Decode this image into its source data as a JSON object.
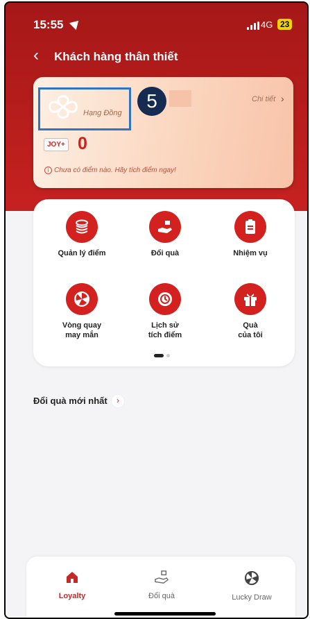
{
  "status_bar": {
    "time": "15:55",
    "network": "4G",
    "battery": "23"
  },
  "nav": {
    "back_icon": "chevron-left-icon",
    "title": "Khách hàng thân thiết"
  },
  "loyalty_card": {
    "tier_label": "Hạng Đồng",
    "annotation_number": "5",
    "detail_label": "Chi tiết",
    "currency_badge": "JOY+",
    "points": "0",
    "notice": "Chưa có điểm nào. Hãy tích điểm ngay!"
  },
  "menu": {
    "items": [
      {
        "label": "Quản lý điểm",
        "icon": "stack-icon"
      },
      {
        "label": "Đổi quà",
        "icon": "gift-hand-icon"
      },
      {
        "label": "Nhiệm vụ",
        "icon": "clipboard-icon"
      },
      {
        "label": "Vòng quay\nmay mắn",
        "icon": "fan-icon"
      },
      {
        "label": "Lịch sử\ntích điểm",
        "icon": "history-icon"
      },
      {
        "label": "Quà\ncủa tôi",
        "icon": "gift-box-icon"
      }
    ],
    "page_indicator": {
      "current": 1,
      "total": 2
    }
  },
  "section": {
    "title": "Đổi quà mới nhất"
  },
  "tab_bar": {
    "tabs": [
      {
        "label": "Loyalty",
        "icon": "home-icon",
        "active": true
      },
      {
        "label": "Đổi quà",
        "icon": "gift-hand-icon",
        "active": false
      },
      {
        "label": "Lucky Draw",
        "icon": "fan-icon",
        "active": false
      }
    ]
  },
  "colors": {
    "brand_red": "#d3211f",
    "annotation_box": "#2f74c2",
    "annotation_badge": "#152b52"
  }
}
